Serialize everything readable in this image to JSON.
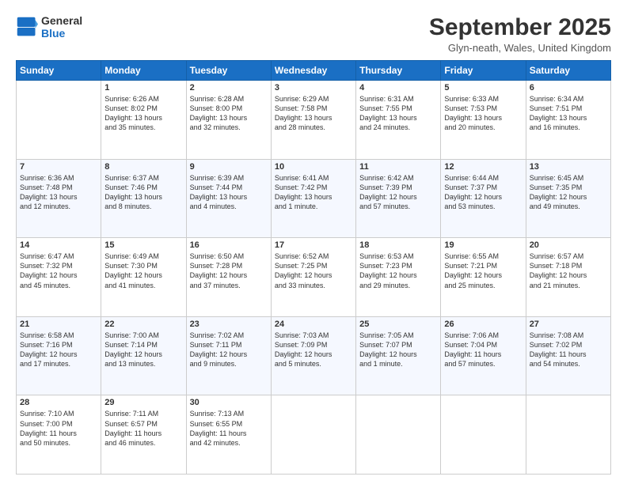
{
  "header": {
    "logo_line1": "General",
    "logo_line2": "Blue",
    "month": "September 2025",
    "location": "Glyn-neath, Wales, United Kingdom"
  },
  "days_of_week": [
    "Sunday",
    "Monday",
    "Tuesday",
    "Wednesday",
    "Thursday",
    "Friday",
    "Saturday"
  ],
  "weeks": [
    [
      {
        "day": "",
        "content": ""
      },
      {
        "day": "1",
        "content": "Sunrise: 6:26 AM\nSunset: 8:02 PM\nDaylight: 13 hours\nand 35 minutes."
      },
      {
        "day": "2",
        "content": "Sunrise: 6:28 AM\nSunset: 8:00 PM\nDaylight: 13 hours\nand 32 minutes."
      },
      {
        "day": "3",
        "content": "Sunrise: 6:29 AM\nSunset: 7:58 PM\nDaylight: 13 hours\nand 28 minutes."
      },
      {
        "day": "4",
        "content": "Sunrise: 6:31 AM\nSunset: 7:55 PM\nDaylight: 13 hours\nand 24 minutes."
      },
      {
        "day": "5",
        "content": "Sunrise: 6:33 AM\nSunset: 7:53 PM\nDaylight: 13 hours\nand 20 minutes."
      },
      {
        "day": "6",
        "content": "Sunrise: 6:34 AM\nSunset: 7:51 PM\nDaylight: 13 hours\nand 16 minutes."
      }
    ],
    [
      {
        "day": "7",
        "content": "Sunrise: 6:36 AM\nSunset: 7:48 PM\nDaylight: 13 hours\nand 12 minutes."
      },
      {
        "day": "8",
        "content": "Sunrise: 6:37 AM\nSunset: 7:46 PM\nDaylight: 13 hours\nand 8 minutes."
      },
      {
        "day": "9",
        "content": "Sunrise: 6:39 AM\nSunset: 7:44 PM\nDaylight: 13 hours\nand 4 minutes."
      },
      {
        "day": "10",
        "content": "Sunrise: 6:41 AM\nSunset: 7:42 PM\nDaylight: 13 hours\nand 1 minute."
      },
      {
        "day": "11",
        "content": "Sunrise: 6:42 AM\nSunset: 7:39 PM\nDaylight: 12 hours\nand 57 minutes."
      },
      {
        "day": "12",
        "content": "Sunrise: 6:44 AM\nSunset: 7:37 PM\nDaylight: 12 hours\nand 53 minutes."
      },
      {
        "day": "13",
        "content": "Sunrise: 6:45 AM\nSunset: 7:35 PM\nDaylight: 12 hours\nand 49 minutes."
      }
    ],
    [
      {
        "day": "14",
        "content": "Sunrise: 6:47 AM\nSunset: 7:32 PM\nDaylight: 12 hours\nand 45 minutes."
      },
      {
        "day": "15",
        "content": "Sunrise: 6:49 AM\nSunset: 7:30 PM\nDaylight: 12 hours\nand 41 minutes."
      },
      {
        "day": "16",
        "content": "Sunrise: 6:50 AM\nSunset: 7:28 PM\nDaylight: 12 hours\nand 37 minutes."
      },
      {
        "day": "17",
        "content": "Sunrise: 6:52 AM\nSunset: 7:25 PM\nDaylight: 12 hours\nand 33 minutes."
      },
      {
        "day": "18",
        "content": "Sunrise: 6:53 AM\nSunset: 7:23 PM\nDaylight: 12 hours\nand 29 minutes."
      },
      {
        "day": "19",
        "content": "Sunrise: 6:55 AM\nSunset: 7:21 PM\nDaylight: 12 hours\nand 25 minutes."
      },
      {
        "day": "20",
        "content": "Sunrise: 6:57 AM\nSunset: 7:18 PM\nDaylight: 12 hours\nand 21 minutes."
      }
    ],
    [
      {
        "day": "21",
        "content": "Sunrise: 6:58 AM\nSunset: 7:16 PM\nDaylight: 12 hours\nand 17 minutes."
      },
      {
        "day": "22",
        "content": "Sunrise: 7:00 AM\nSunset: 7:14 PM\nDaylight: 12 hours\nand 13 minutes."
      },
      {
        "day": "23",
        "content": "Sunrise: 7:02 AM\nSunset: 7:11 PM\nDaylight: 12 hours\nand 9 minutes."
      },
      {
        "day": "24",
        "content": "Sunrise: 7:03 AM\nSunset: 7:09 PM\nDaylight: 12 hours\nand 5 minutes."
      },
      {
        "day": "25",
        "content": "Sunrise: 7:05 AM\nSunset: 7:07 PM\nDaylight: 12 hours\nand 1 minute."
      },
      {
        "day": "26",
        "content": "Sunrise: 7:06 AM\nSunset: 7:04 PM\nDaylight: 11 hours\nand 57 minutes."
      },
      {
        "day": "27",
        "content": "Sunrise: 7:08 AM\nSunset: 7:02 PM\nDaylight: 11 hours\nand 54 minutes."
      }
    ],
    [
      {
        "day": "28",
        "content": "Sunrise: 7:10 AM\nSunset: 7:00 PM\nDaylight: 11 hours\nand 50 minutes."
      },
      {
        "day": "29",
        "content": "Sunrise: 7:11 AM\nSunset: 6:57 PM\nDaylight: 11 hours\nand 46 minutes."
      },
      {
        "day": "30",
        "content": "Sunrise: 7:13 AM\nSunset: 6:55 PM\nDaylight: 11 hours\nand 42 minutes."
      },
      {
        "day": "",
        "content": ""
      },
      {
        "day": "",
        "content": ""
      },
      {
        "day": "",
        "content": ""
      },
      {
        "day": "",
        "content": ""
      }
    ]
  ]
}
